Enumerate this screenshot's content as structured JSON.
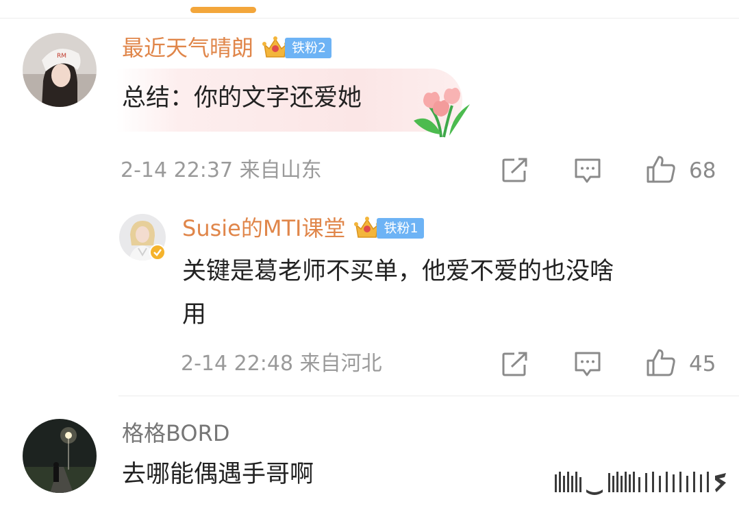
{
  "colors": {
    "accent": "#f3a63b",
    "vip_name": "#e0864a",
    "badge_blue": "#6db3f5",
    "meta_gray": "#9a9a9a"
  },
  "comments": [
    {
      "username": "最近天气晴朗",
      "fan_badge": "铁粉2",
      "text": "总结：你的文字还爱她",
      "sticker": "tulip-sticker",
      "meta": "2-14 22:37  来自山东",
      "likes": "68",
      "icons": [
        "share-icon",
        "comment-icon",
        "like-icon"
      ]
    },
    {
      "username": "Susie的MTI课堂",
      "fan_badge": "铁粉1",
      "verified": "verified-badge-icon",
      "text_line1": "关键是葛老师不买单，他爱不爱的也没啥",
      "text_line2": "用",
      "meta": "2-14 22:48  来自河北",
      "likes": "45",
      "icons": [
        "share-icon",
        "comment-icon",
        "like-icon"
      ]
    },
    {
      "username": "格格BORD",
      "text": "去哪能偶遇手哥啊"
    }
  ]
}
